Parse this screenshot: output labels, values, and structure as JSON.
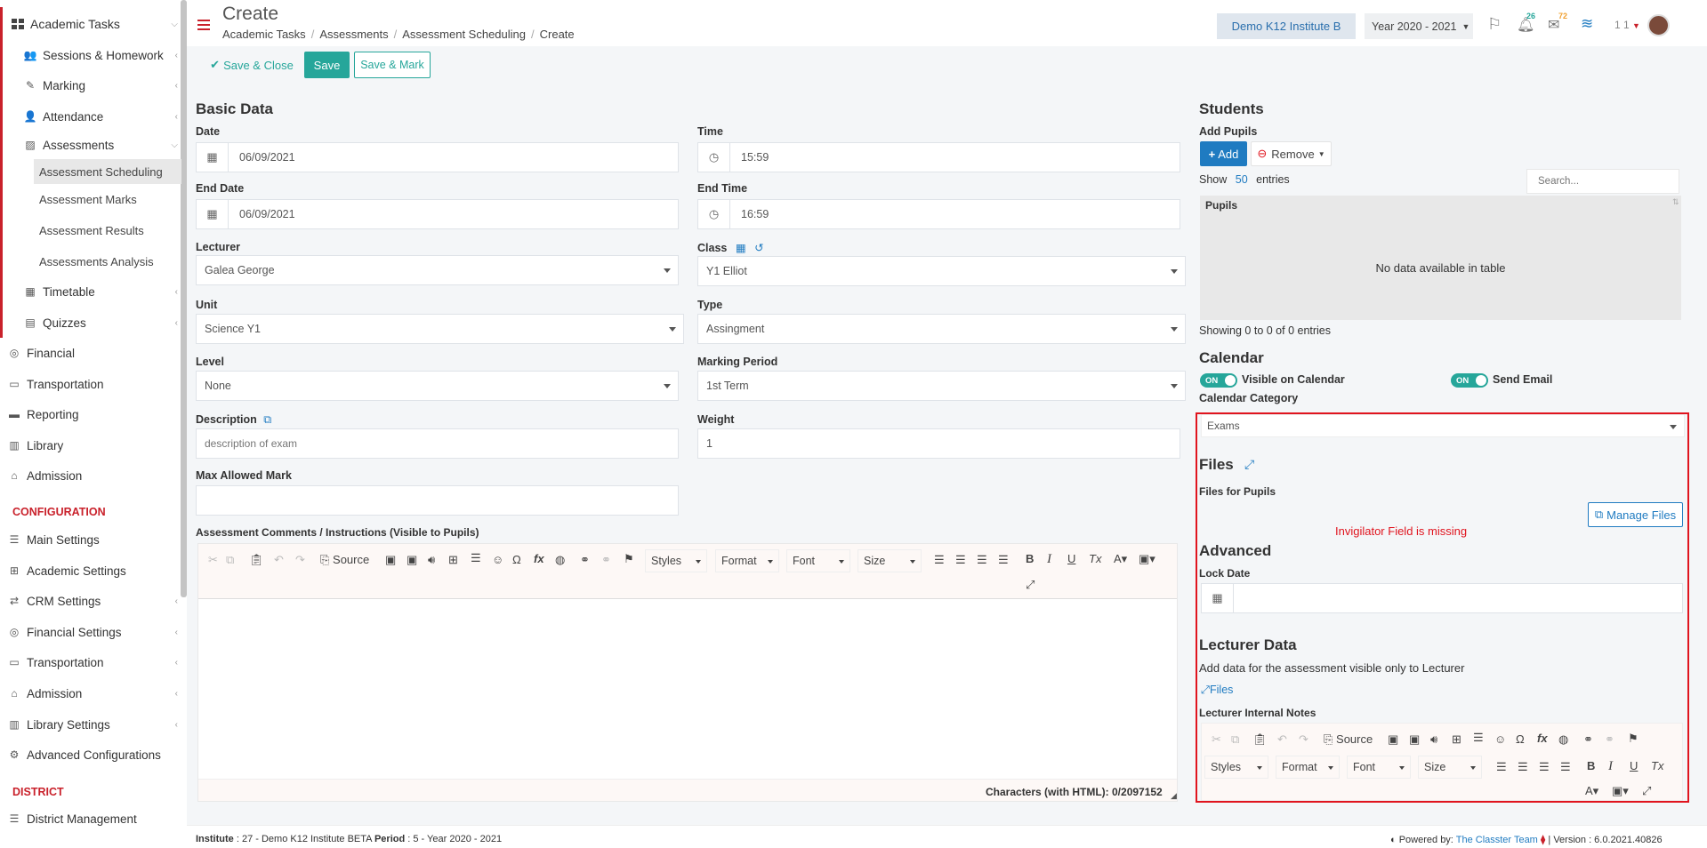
{
  "sidebar": {
    "items": [
      {
        "label": "Academic Tasks",
        "icon": "grid-icon"
      },
      {
        "label": "Sessions & Homework",
        "icon": "users-icon"
      },
      {
        "label": "Marking",
        "icon": "edit-icon"
      },
      {
        "label": "Attendance",
        "icon": "user-check-icon"
      },
      {
        "label": "Assessments",
        "icon": "pencil-square-icon"
      },
      {
        "label": "Assessment Scheduling"
      },
      {
        "label": "Assessment Marks"
      },
      {
        "label": "Assessment Results"
      },
      {
        "label": "Assessments Analysis"
      },
      {
        "label": "Timetable",
        "icon": "calendar-icon"
      },
      {
        "label": "Quizzes",
        "icon": "clipboard-icon"
      },
      {
        "label": "Financial",
        "icon": "coins-icon"
      },
      {
        "label": "Transportation",
        "icon": "bus-icon"
      },
      {
        "label": "Reporting",
        "icon": "printer-icon"
      },
      {
        "label": "Library",
        "icon": "books-icon"
      },
      {
        "label": "Admission",
        "icon": "institution-icon"
      }
    ],
    "config_title": "CONFIGURATION",
    "config_items": [
      {
        "label": "Main Settings",
        "icon": "sliders-icon"
      },
      {
        "label": "Academic Settings",
        "icon": "sitemap-icon"
      },
      {
        "label": "CRM Settings",
        "icon": "shuffle-icon"
      },
      {
        "label": "Financial Settings",
        "icon": "coins-icon"
      },
      {
        "label": "Transportation",
        "icon": "bus-icon"
      },
      {
        "label": "Admission",
        "icon": "institution-icon"
      },
      {
        "label": "Library Settings",
        "icon": "books-icon"
      },
      {
        "label": "Advanced Configurations",
        "icon": "gears-icon"
      }
    ],
    "district_title": "DISTRICT",
    "district_items": [
      {
        "label": "District Management",
        "icon": "list-icon"
      }
    ]
  },
  "header": {
    "title": "Create",
    "breadcrumbs": [
      "Academic Tasks",
      "Assessments",
      "Assessment Scheduling",
      "Create"
    ],
    "institute": "Demo K12 Institute B",
    "year": "Year 2020 - 2021",
    "notif_count": "26",
    "mail_count": "72",
    "user_short": "1 1"
  },
  "toolbar": {
    "save_close": "Save & Close",
    "save": "Save",
    "save_mark": "Save & Mark"
  },
  "basic": {
    "title": "Basic Data",
    "date_label": "Date",
    "date_value": "06/09/2021",
    "time_label": "Time",
    "time_value": "15:59",
    "end_date_label": "End Date",
    "end_date_value": "06/09/2021",
    "end_time_label": "End Time",
    "end_time_value": "16:59",
    "lecturer_label": "Lecturer",
    "lecturer_value": "Galea George",
    "class_label": "Class",
    "class_value": "Y1 Elliot",
    "unit_label": "Unit",
    "unit_value": "Science Y1",
    "type_label": "Type",
    "type_value": "Assingment",
    "level_label": "Level",
    "level_value": "None",
    "marking_period_label": "Marking Period",
    "marking_period_value": "1st Term",
    "description_label": "Description",
    "description_placeholder": "description of exam",
    "weight_label": "Weight",
    "weight_value": "1",
    "max_mark_label": "Max Allowed Mark",
    "comments_label": "Assessment Comments / Instructions (Visible to Pupils)",
    "editor": {
      "source": "Source",
      "styles": "Styles",
      "format": "Format",
      "font": "Font",
      "size": "Size",
      "char_count": "Characters (with HTML): 0/2097152"
    }
  },
  "students": {
    "title": "Students",
    "add_pupils": "Add Pupils",
    "add_btn": "Add",
    "remove_btn": "Remove",
    "show": "Show",
    "show_count": "50",
    "entries": "entries",
    "search_placeholder": "Search...",
    "col_pupils": "Pupils",
    "empty": "No data available in table",
    "showing": "Showing 0 to 0 of 0 entries"
  },
  "calendar": {
    "title": "Calendar",
    "toggle_on": "ON",
    "visible_label": "Visible on Calendar",
    "send_email_label": "Send Email",
    "category_label": "Calendar Category",
    "category_value": "Exams"
  },
  "files": {
    "title": "Files",
    "for_pupils": "Files for Pupils",
    "manage": "Manage Files",
    "annotation": "Invigilator Field is missing"
  },
  "advanced": {
    "title": "Advanced",
    "lock_date_label": "Lock Date"
  },
  "lecturer_data": {
    "title": "Lecturer Data",
    "description": "Add data for the assessment visible only to Lecturer",
    "files_link": "Files",
    "notes_label": "Lecturer Internal Notes"
  },
  "footer": {
    "institute_label": "Institute",
    "institute_value": ": 27 - Demo K12 Institute BETA",
    "period_label": "Period",
    "period_value": ": 5 - Year 2020 - 2021",
    "powered": "Powered by:",
    "powered_link": "The Classter Team",
    "version": "| Version : 6.0.2021.40826"
  },
  "colors": {
    "accent": "#26a69a",
    "brand_red": "#c9212b",
    "primary_blue": "#1f7bc1",
    "annotation_red": "#e0141e"
  }
}
